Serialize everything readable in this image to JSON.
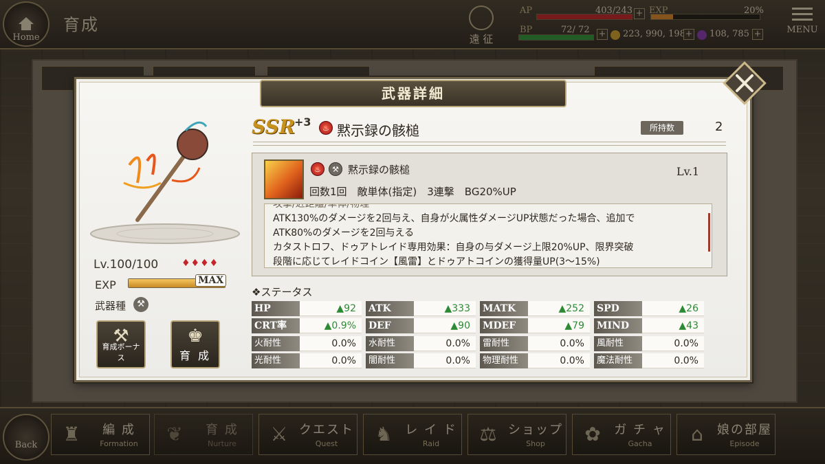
{
  "header": {
    "home_label": "Home",
    "title": "育成",
    "expedition_label": "遠 征",
    "menu_label": "MENU",
    "ap_label": "AP",
    "ap_value": "403/243",
    "exp_label": "EXP",
    "exp_value": "20%",
    "bp_label": "BP",
    "bp_value": "72/ 72",
    "gold_value": "223, 990, 198",
    "gem_value": "108, 785",
    "ap_fill": 1.0,
    "exp_fill": 0.2,
    "bp_fill": 1.0
  },
  "dialog": {
    "title": "武器詳細",
    "rarity": "SSR",
    "plus": "+3",
    "weapon_name": "黙示録の骸槌",
    "own_label": "所持数",
    "own_count": "2",
    "level": "Lv.100/100",
    "stars": "♦♦♦♦",
    "exp_label": "EXP",
    "exp_max": "MAX",
    "exp_fill": 1.0,
    "weapon_type_label": "武器種",
    "bonus_button": "育成ボーナス",
    "nurture_button": "育 成",
    "skill": {
      "name": "黙示録の骸槌",
      "level": "Lv.1",
      "summary": "回数1回　敵単体(指定)　3連撃　BG20%UP",
      "cut_line": "攻撃/近距離/単体/物理",
      "lines": [
        "ATK130%のダメージを2回与え、自身が火属性ダメージUP状態だった場合、追加で",
        "ATK80%のダメージを2回与える",
        "カタストロフ、ドゥアトレイド専用効果：自身の与ダメージ上限20%UP、限界突破",
        "段階に応じてレイドコイン【風雷】とドゥアトコインの獲得量UP(3～15%)"
      ]
    },
    "status_title": "ステータス",
    "main_stats": [
      {
        "label": "HP",
        "value": "▲92"
      },
      {
        "label": "ATK",
        "value": "▲333"
      },
      {
        "label": "MATK",
        "value": "▲252"
      },
      {
        "label": "SPD",
        "value": "▲26"
      },
      {
        "label": "CRT率",
        "value": "▲0.9%"
      },
      {
        "label": "DEF",
        "value": "▲90"
      },
      {
        "label": "MDEF",
        "value": "▲79"
      },
      {
        "label": "MIND",
        "value": "▲43"
      }
    ],
    "resist_stats": [
      {
        "label": "火耐性",
        "value": "0.0%"
      },
      {
        "label": "水耐性",
        "value": "0.0%"
      },
      {
        "label": "雷耐性",
        "value": "0.0%"
      },
      {
        "label": "風耐性",
        "value": "0.0%"
      },
      {
        "label": "光耐性",
        "value": "0.0%"
      },
      {
        "label": "闇耐性",
        "value": "0.0%"
      },
      {
        "label": "物理耐性",
        "value": "0.0%"
      },
      {
        "label": "魔法耐性",
        "value": "0.0%"
      }
    ]
  },
  "nav": {
    "back_label": "Back",
    "items": [
      {
        "jp": "編 成",
        "en": "Formation",
        "icon": "chess-icon"
      },
      {
        "jp": "育 成",
        "en": "Nurture",
        "icon": "nurture-icon"
      },
      {
        "jp": "クエスト",
        "en": "Quest",
        "icon": "swords-icon"
      },
      {
        "jp": "レ イ ド",
        "en": "Raid",
        "icon": "dragon-icon"
      },
      {
        "jp": "ショップ",
        "en": "Shop",
        "icon": "scale-icon"
      },
      {
        "jp": "ガ チ ャ",
        "en": "Gacha",
        "icon": "flower-icon"
      },
      {
        "jp": "娘の部屋",
        "en": "Episode",
        "icon": "door-icon"
      }
    ]
  },
  "colors": {
    "ap_bar": "#c9242a",
    "exp_bar": "#e08c2a",
    "bp_bar": "#2c9a3c",
    "stat_up": "#2c8a34",
    "rarity_gold": "#c7911d"
  }
}
